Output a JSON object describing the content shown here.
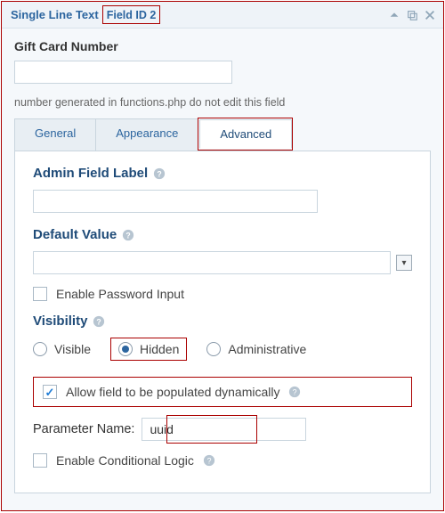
{
  "header": {
    "title": "Single Line Text",
    "field_id": "Field ID 2"
  },
  "gift_card": {
    "label": "Gift Card Number",
    "value": "",
    "note": "number generated in functions.php do not edit this field"
  },
  "tabs": {
    "general": "General",
    "appearance": "Appearance",
    "advanced": "Advanced",
    "active": "advanced"
  },
  "advanced": {
    "admin_field_label": {
      "label": "Admin Field Label",
      "value": ""
    },
    "default_value": {
      "label": "Default Value",
      "value": ""
    },
    "enable_password": {
      "label": "Enable Password Input",
      "checked": false
    },
    "visibility": {
      "label": "Visibility",
      "options": {
        "visible": "Visible",
        "hidden": "Hidden",
        "administrative": "Administrative"
      },
      "selected": "hidden"
    },
    "allow_dynamic": {
      "label": "Allow field to be populated dynamically",
      "checked": true
    },
    "parameter_name": {
      "label": "Parameter Name:",
      "value": "uuid"
    },
    "conditional_logic": {
      "label": "Enable Conditional Logic",
      "checked": false
    }
  }
}
